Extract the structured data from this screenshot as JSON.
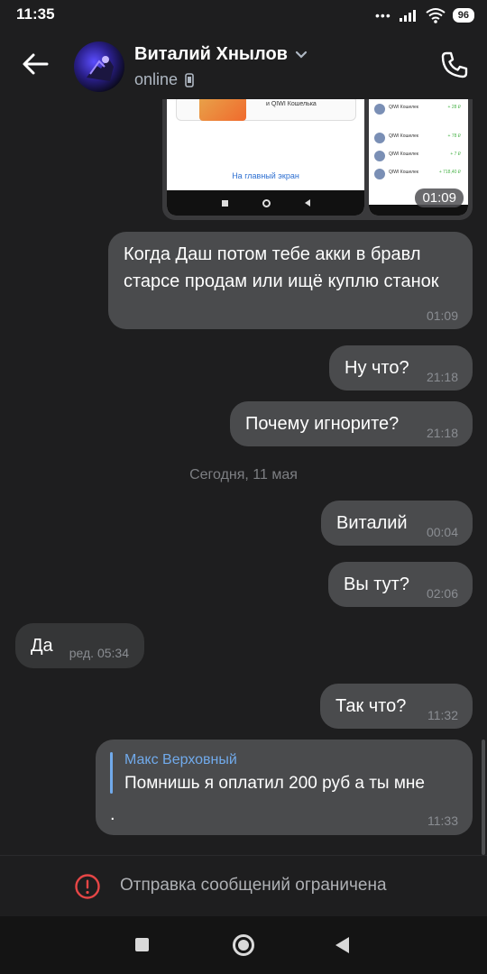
{
  "status_bar": {
    "time": "11:35",
    "battery": "96",
    "icons": [
      "dots-icon",
      "signal-icon",
      "wifi-icon",
      "battery-icon"
    ]
  },
  "header": {
    "name": "Виталий Хнылов",
    "status": "online",
    "icons": [
      "back-arrow-icon",
      "chevron-down-icon",
      "mobile-device-icon",
      "phone-call-icon"
    ]
  },
  "media_message": {
    "preview_caption": "и QIWI Кошелька",
    "preview_link": "На главный экран",
    "video_duration": "01:09",
    "list_rows": [
      {
        "t": "QIWI Кошелек",
        "v": "+ 28 ₽"
      },
      {
        "t": "QIWI Кошелек",
        "v": "+ 78 ₽"
      },
      {
        "t": "QIWI Кошелек",
        "v": "+ 7 ₽"
      },
      {
        "t": "QIWI Кошелек",
        "v": "+ 718,40 ₽"
      }
    ]
  },
  "messages": [
    {
      "text": "Когда Даш потом тебе акки в бравл старсе продам или ищё куплю станок",
      "time": "01:09",
      "direction": "out"
    },
    {
      "text": "Ну что?",
      "time": "21:18",
      "direction": "out"
    },
    {
      "text": "Почему игнорите?",
      "time": "21:18",
      "direction": "out"
    },
    {
      "text": "Виталий",
      "time": "00:04",
      "direction": "out"
    },
    {
      "text": "Вы тут?",
      "time": "02:06",
      "direction": "out"
    },
    {
      "text": "Да",
      "time": "ред. 05:34",
      "direction": "in"
    },
    {
      "text": "Так что?",
      "time": "11:32",
      "direction": "out"
    }
  ],
  "day_separator": "Сегодня, 11 мая",
  "reply_message": {
    "quoted_author": "Макс Верховный",
    "quoted_text": "Помнишь я оплатил 200 руб а ты мне",
    "text": ".",
    "time": "11:33"
  },
  "restriction": {
    "text": "Отправка сообщений ограничена",
    "icon": "alert-circle-icon"
  },
  "colors": {
    "background": "#1e1e1f",
    "bubble_out": "#4a4b4d",
    "bubble_in": "#353637",
    "accent": "#71aaeb",
    "alert": "#e64646"
  }
}
